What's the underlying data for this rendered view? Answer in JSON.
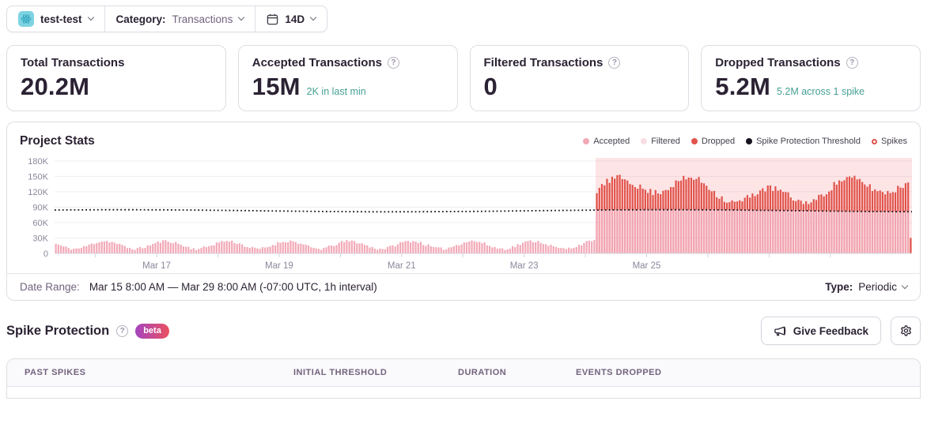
{
  "topbar": {
    "project": "test-test",
    "category_label": "Category:",
    "category_value": "Transactions",
    "period": "14D"
  },
  "stat_cards": [
    {
      "title": "Total Transactions",
      "value": "20.2M",
      "subtext": ""
    },
    {
      "title": "Accepted Transactions",
      "value": "15M",
      "subtext": "2K in last min"
    },
    {
      "title": "Filtered Transactions",
      "value": "0",
      "subtext": ""
    },
    {
      "title": "Dropped Transactions",
      "value": "5.2M",
      "subtext": "5.2M across 1 spike"
    }
  ],
  "chart": {
    "title": "Project Stats",
    "legend": [
      {
        "label": "Accepted",
        "color": "#f2a9b7",
        "marker": "dot"
      },
      {
        "label": "Filtered",
        "color": "#f8dde3",
        "marker": "dot"
      },
      {
        "label": "Dropped",
        "color": "#e1544b",
        "marker": "dot"
      },
      {
        "label": "Spike Protection Threshold",
        "color": "#17131f",
        "marker": "dot"
      },
      {
        "label": "Spikes",
        "color": "#e1544b",
        "marker": "ring"
      }
    ]
  },
  "chart_data": {
    "type": "bar",
    "title": "Project Stats",
    "interval": "1h",
    "x_start": "Mar 15 8:00 AM",
    "x_end": "Mar 29 8:00 AM",
    "bars_count": 336,
    "x_tick_labels": [
      "Mar 17",
      "Mar 19",
      "Mar 21",
      "Mar 23",
      "Mar 25"
    ],
    "labeled_day_offsets": [
      1,
      3,
      5,
      7,
      9
    ],
    "y_tick_labels": [
      "180K",
      "150K",
      "120K",
      "90K",
      "60K",
      "30K",
      "0"
    ],
    "y_tick_values_k": [
      180,
      150,
      120,
      90,
      60,
      30,
      0
    ],
    "ylim_k": [
      0,
      186
    ],
    "threshold_k": 83,
    "pre_spike_accepted_k": {
      "min": 6,
      "max": 31,
      "mean": 16.5,
      "pattern": "daily sinusoid with noise"
    },
    "spike_window": {
      "start_index": 212,
      "end_index": 336,
      "accepted_capped_at_threshold": true,
      "total_k_range": [
        96,
        161
      ],
      "total_k_mean": 123
    },
    "filtered_constant_k": 0,
    "last_bar_dropped_k": 30,
    "seed": 11,
    "colors": {
      "accepted": "#f2a9b7",
      "filtered": "#f8dde3",
      "dropped": "#e1544b",
      "threshold": "#17131f",
      "spike_region_bg": "rgba(244,84,94,0.10)",
      "spike_region_tint": "rgba(226,73,84,0.05)",
      "grid": "#efedf3",
      "axis": "#d6d3dd",
      "axis_text": "#8d879c"
    }
  },
  "date_range": {
    "label": "Date Range:",
    "value": "Mar 15 8:00 AM — Mar 29 8:00 AM (-07:00 UTC, 1h interval)",
    "type_label": "Type:",
    "type_value": "Periodic"
  },
  "spike_protection": {
    "title": "Spike Protection",
    "badge": "beta",
    "feedback_label": "Give Feedback"
  },
  "table": {
    "columns": [
      "PAST SPIKES",
      "INITIAL THRESHOLD",
      "DURATION",
      "EVENTS DROPPED"
    ]
  },
  "colors": {
    "subtext_teal": "#45a094",
    "help_q": "?"
  }
}
